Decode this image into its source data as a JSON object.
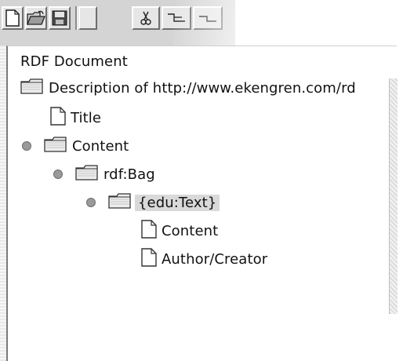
{
  "toolbar": {
    "buttons": [
      {
        "name": "new-document",
        "icon": "blank-page-icon"
      },
      {
        "name": "open-folder",
        "icon": "open-folder-icon"
      },
      {
        "name": "save",
        "icon": "floppy-disk-icon"
      },
      {
        "name": "cut",
        "icon": "scissors-icon"
      },
      {
        "name": "tree-layout-1",
        "icon": "tree-layout-icon"
      },
      {
        "name": "tree-layout-2",
        "icon": "tree-layout-icon"
      }
    ]
  },
  "tree": {
    "root_label": "RDF Document",
    "nodes": [
      {
        "label": "Description of http://www.ekengren.com/rd",
        "icon": "folder-icon",
        "level": 0,
        "handle": false
      },
      {
        "label": "Title",
        "icon": "document-icon",
        "level": 1,
        "handle": false
      },
      {
        "label": "Content",
        "icon": "folder-icon",
        "level": 1,
        "handle": true
      },
      {
        "label": "rdf:Bag",
        "icon": "folder-icon",
        "level": 2,
        "handle": true
      },
      {
        "label": "{edu:Text}",
        "icon": "folder-icon",
        "level": 3,
        "handle": true,
        "selected": true
      },
      {
        "label": "Content",
        "icon": "document-icon",
        "level": 4,
        "handle": false
      },
      {
        "label": "Author/Creator",
        "icon": "document-icon",
        "level": 4,
        "handle": false
      }
    ]
  }
}
